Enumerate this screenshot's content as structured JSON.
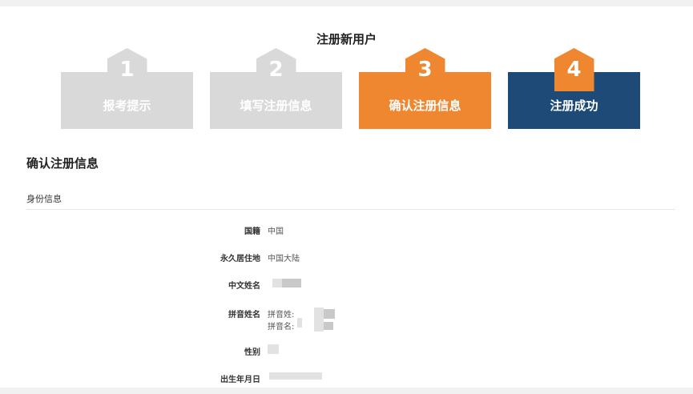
{
  "page_title": "注册新用户",
  "steps": [
    {
      "number": "1",
      "label": "报考提示",
      "state": "done"
    },
    {
      "number": "2",
      "label": "填写注册信息",
      "state": "done"
    },
    {
      "number": "3",
      "label": "确认注册信息",
      "state": "current"
    },
    {
      "number": "4",
      "label": "注册成功",
      "state": "final"
    }
  ],
  "colors": {
    "inactive": "#d9d9d9",
    "active": "#ef8731",
    "final": "#1d4a77"
  },
  "section": {
    "title": "确认注册信息",
    "subtitle": "身份信息"
  },
  "fields": {
    "nationality": {
      "label": "国籍",
      "value": "中国"
    },
    "residence": {
      "label": "永久居住地",
      "value": "中国大陆"
    },
    "chinese_name": {
      "label": "中文姓名",
      "value": ""
    },
    "pinyin_name": {
      "label": "拼音姓名",
      "surname_label": "拼音姓:",
      "given_label": "拼音名:"
    },
    "gender": {
      "label": "性别",
      "value": ""
    },
    "birth_date": {
      "label": "出生年月日",
      "value": ""
    }
  }
}
